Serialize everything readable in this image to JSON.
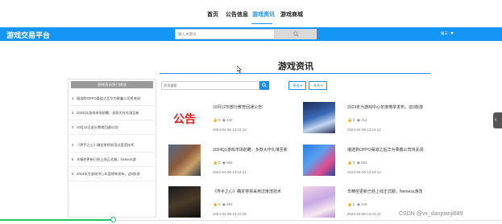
{
  "nav": {
    "items": [
      "首页",
      "公告信息",
      "游戏资讯",
      "游戏商城"
    ],
    "active_index": 2
  },
  "header": {
    "logo": "游戏交易平台",
    "search_placeholder": "输入关键词",
    "user_label": "展三",
    "colors": {
      "brand": "#1596f5",
      "accent": "#1e8de8"
    }
  },
  "page": {
    "title": "游戏资讯"
  },
  "sidebar": {
    "title": "游戏资讯热门阅读",
    "items": [
      {
        "num": "1",
        "text": "瑞选购OPPO渠道之后华为果鑫公司将关闭"
      },
      {
        "num": "2",
        "text": "2024Q1游戏市场前瞻：多款大作扎堆至新"
      },
      {
        "num": "3",
        "text": "10月12日部分教育回通公告!"
      },
      {
        "num": "4",
        "text": "《界手之心》确定将将采用过度渲技术"
      },
      {
        "num": "5",
        "text": "辛精控更新已经上线正式服，Nemess游"
      },
      {
        "num": "6",
        "text": "2023年为游戏中心年度榜单发布，这0款游"
      }
    ]
  },
  "filter": {
    "placeholder": "资讯搜索",
    "buttons": [
      "筛选",
      "排序"
    ]
  },
  "cards": [
    {
      "title": "10月12日部分教育回通公告!",
      "likes": "0",
      "views": "332",
      "date": "2024-04-06 13:24:12",
      "thumb": "notice"
    },
    {
      "title": "2023年为游戏中心年度榜单发布，这0款游",
      "likes": "0",
      "views": "214",
      "date": "2024-04-06 13:24:12",
      "thumb": "anime-blue"
    },
    {
      "title": "2024Q1游戏市场前瞻：多款大作扎堆至新",
      "likes": "0",
      "views": "582",
      "date": "2024-04-06 13:24:12",
      "thumb": "battle"
    },
    {
      "title": "瑞选购OPPO渠道之后华为果鑫公司将关闭",
      "likes": "0",
      "views": "852",
      "date": "2024-04-06 13:24:12",
      "thumb": "promo"
    },
    {
      "title": "《界手之心》确定将将采用过度渲技术",
      "likes": "0",
      "views": "292",
      "date": "2024-04-06 13:24:12",
      "thumb": "dark"
    },
    {
      "title": "辛精控更新已经上线正式服，Nemess游改",
      "likes": "0",
      "views": "216",
      "date": "2024-04-06 13:24:12",
      "thumb": "anime-pink"
    }
  ],
  "footer": {
    "watermark": "CSDN @vx_danpianji889",
    "progress": 0.225
  }
}
